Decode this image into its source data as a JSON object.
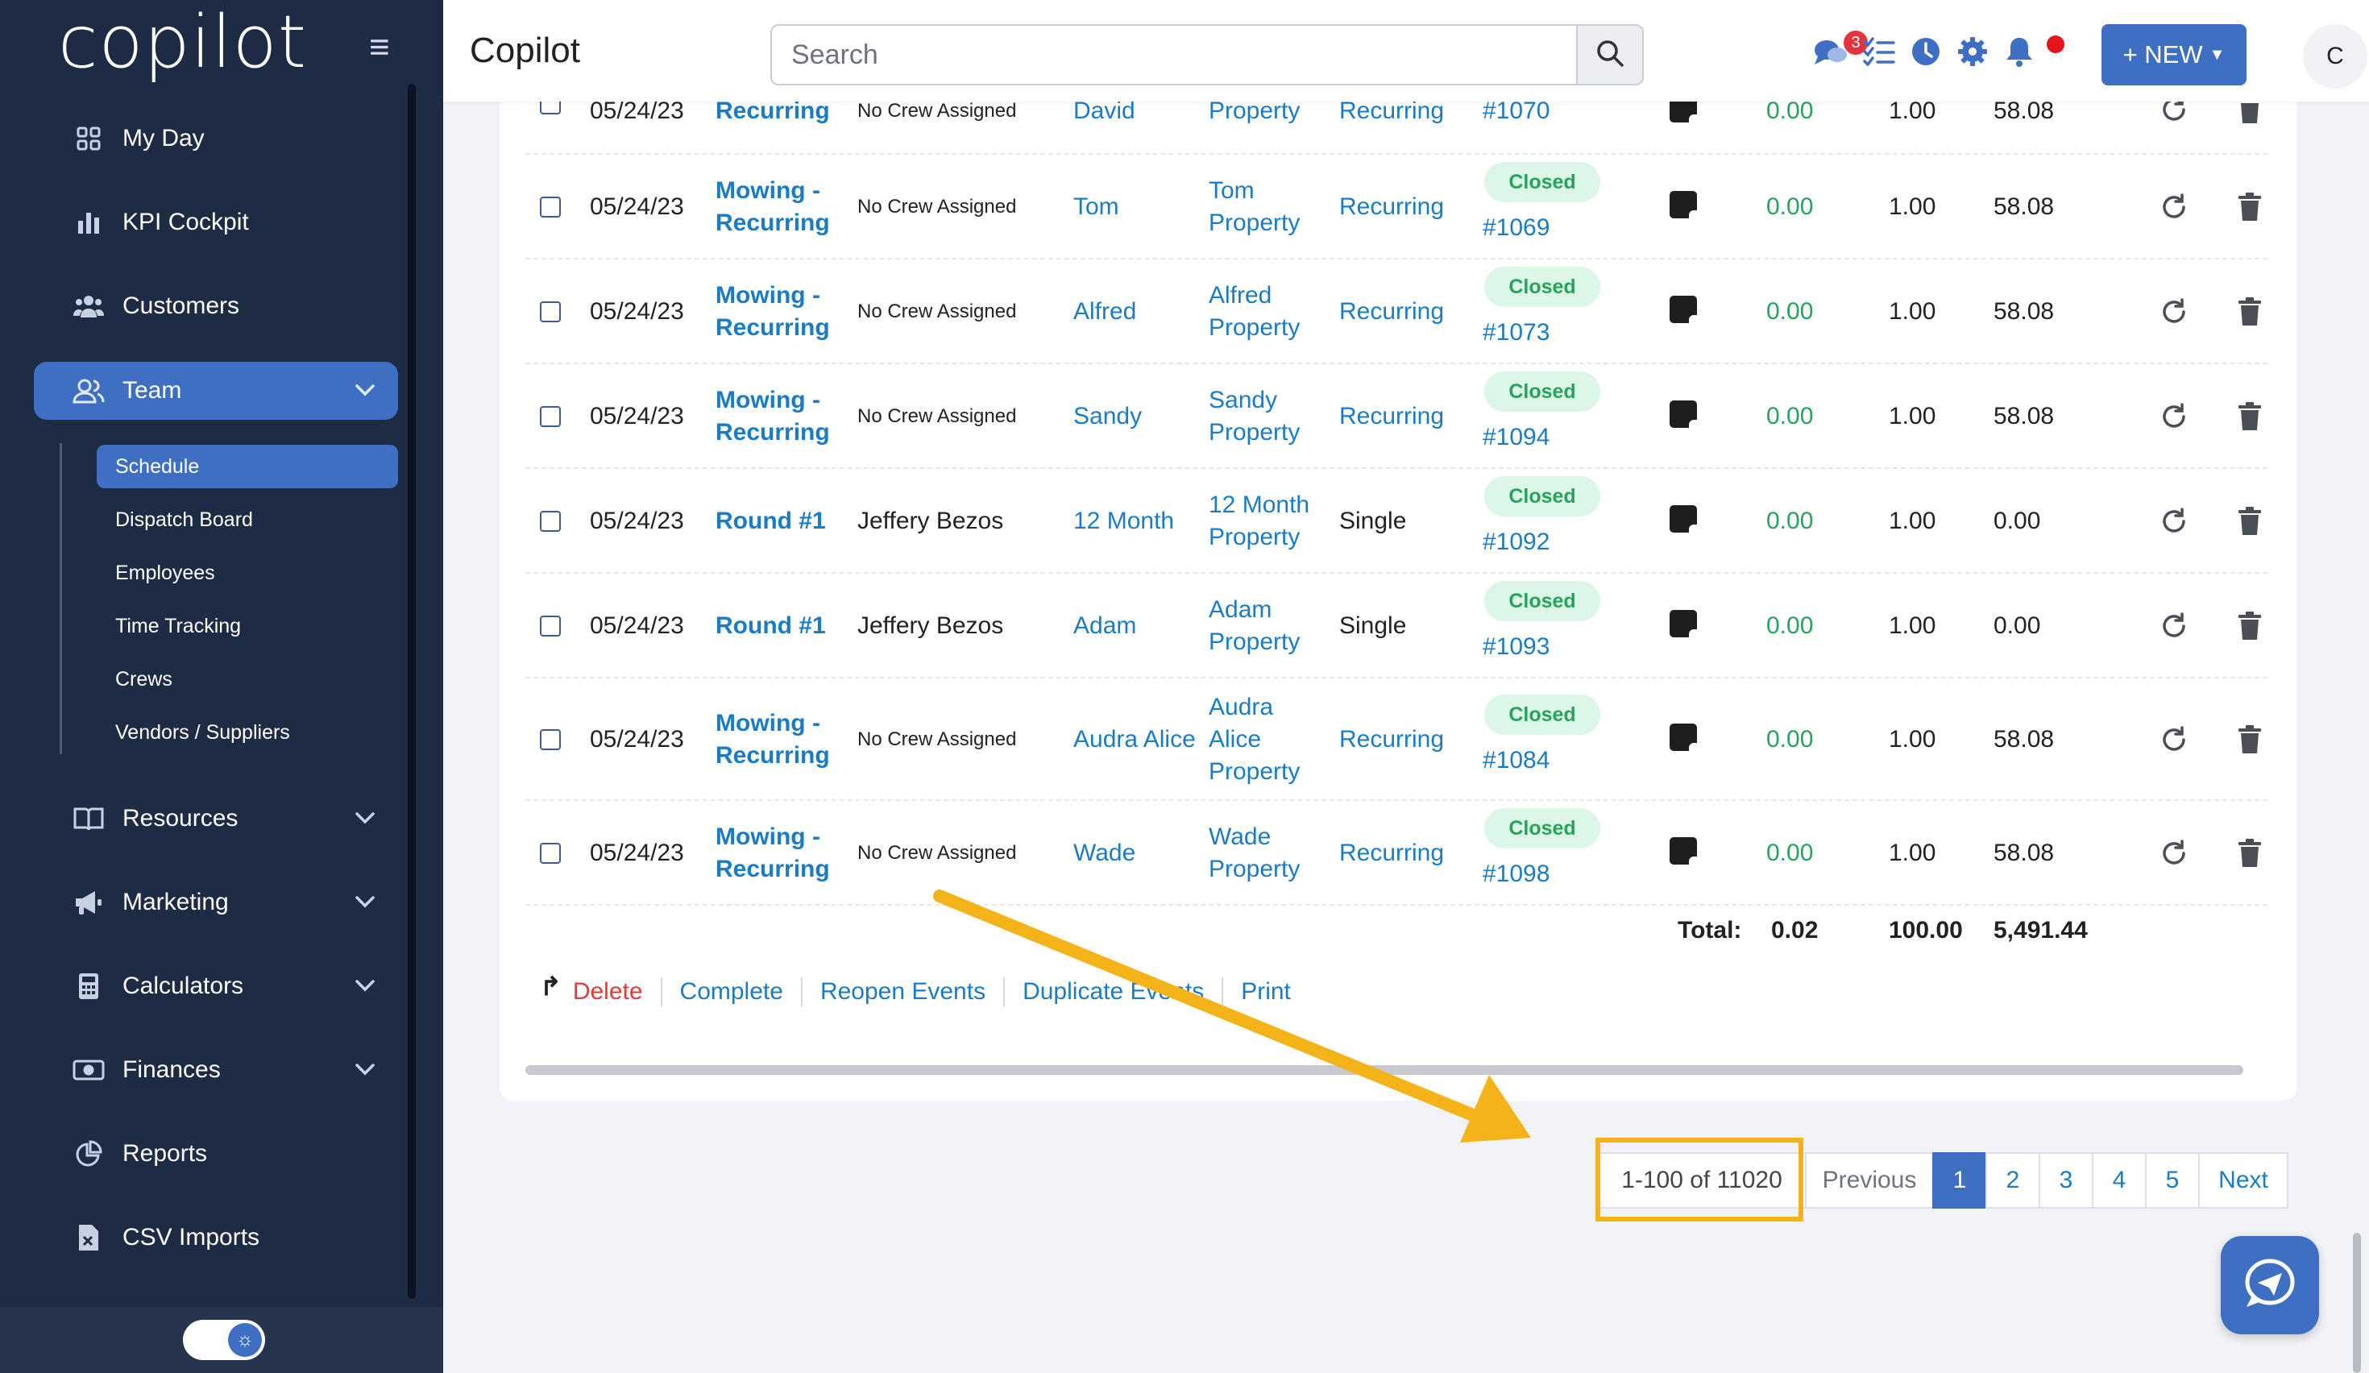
{
  "sidebar": {
    "logo": "copilot",
    "nav": [
      {
        "label": "My Day",
        "icon": "grid-icon"
      },
      {
        "label": "KPI Cockpit",
        "icon": "bar-chart-icon"
      },
      {
        "label": "Customers",
        "icon": "users-icon"
      },
      {
        "label": "Team",
        "icon": "user-group-icon"
      },
      {
        "label": "Resources",
        "icon": "book-icon"
      },
      {
        "label": "Marketing",
        "icon": "megaphone-icon"
      },
      {
        "label": "Calculators",
        "icon": "calculator-icon"
      },
      {
        "label": "Finances",
        "icon": "money-icon"
      },
      {
        "label": "Reports",
        "icon": "pie-chart-icon"
      },
      {
        "label": "CSV Imports",
        "icon": "csv-file-icon"
      }
    ],
    "team_sub": [
      "Schedule",
      "Dispatch Board",
      "Employees",
      "Time Tracking",
      "Crews",
      "Vendors / Suppliers"
    ]
  },
  "header": {
    "title": "Copilot",
    "search_placeholder": "Search",
    "messages_badge": "3",
    "new_label": "+ NEW",
    "avatar": "C"
  },
  "table": {
    "partial_row": {
      "date": "05/24/23",
      "service": "Recurring",
      "crew": "No Crew Assigned",
      "customer": "David",
      "property": "Property",
      "type": "Recurring",
      "invoice": "#1070",
      "amount": "0.00",
      "hours": "1.00",
      "total": "58.08"
    },
    "rows": [
      {
        "date": "05/24/23",
        "service": "Mowing - Recurring",
        "crew": "No Crew Assigned",
        "customer": "Tom",
        "property": "Tom Property",
        "type": "Recurring",
        "status": "Closed",
        "invoice": "#1069",
        "amount": "0.00",
        "hours": "1.00",
        "total": "58.08"
      },
      {
        "date": "05/24/23",
        "service": "Mowing - Recurring",
        "crew": "No Crew Assigned",
        "customer": "Alfred",
        "property": "Alfred Property",
        "type": "Recurring",
        "status": "Closed",
        "invoice": "#1073",
        "amount": "0.00",
        "hours": "1.00",
        "total": "58.08"
      },
      {
        "date": "05/24/23",
        "service": "Mowing - Recurring",
        "crew": "No Crew Assigned",
        "customer": "Sandy",
        "property": "Sandy Property",
        "type": "Recurring",
        "status": "Closed",
        "invoice": "#1094",
        "amount": "0.00",
        "hours": "1.00",
        "total": "58.08"
      },
      {
        "date": "05/24/23",
        "service": "Round #1",
        "crew": "Jeffery Bezos",
        "customer": "12 Month",
        "property": "12 Month Property",
        "type": "Single",
        "status": "Closed",
        "invoice": "#1092",
        "amount": "0.00",
        "hours": "1.00",
        "total": "0.00"
      },
      {
        "date": "05/24/23",
        "service": "Round #1",
        "crew": "Jeffery Bezos",
        "customer": "Adam",
        "property": "Adam Property",
        "type": "Single",
        "status": "Closed",
        "invoice": "#1093",
        "amount": "0.00",
        "hours": "1.00",
        "total": "0.00"
      },
      {
        "date": "05/24/23",
        "service": "Mowing - Recurring",
        "crew": "No Crew Assigned",
        "customer": "Audra Alice",
        "property": "Audra Alice Property",
        "type": "Recurring",
        "status": "Closed",
        "invoice": "#1084",
        "amount": "0.00",
        "hours": "1.00",
        "total": "58.08"
      },
      {
        "date": "05/24/23",
        "service": "Mowing - Recurring",
        "crew": "No Crew Assigned",
        "customer": "Wade",
        "property": "Wade Property",
        "type": "Recurring",
        "status": "Closed",
        "invoice": "#1098",
        "amount": "0.00",
        "hours": "1.00",
        "total": "58.08"
      }
    ],
    "totals": {
      "label": "Total:",
      "amount": "0.02",
      "hours": "100.00",
      "total": "5,491.44"
    }
  },
  "bulk_actions": [
    "Delete",
    "Complete",
    "Reopen Events",
    "Duplicate Events",
    "Print"
  ],
  "pagination": {
    "range": "1-100 of 11020",
    "previous": "Previous",
    "pages": [
      "1",
      "2",
      "3",
      "4",
      "5"
    ],
    "next": "Next"
  },
  "colors": {
    "accent": "#3e6fc3",
    "sidebar": "#1d2b45",
    "link": "#1a7bc7",
    "closed_bg": "#dcf6e7",
    "closed_text": "#28a35c",
    "highlight": "#f5b31a"
  }
}
